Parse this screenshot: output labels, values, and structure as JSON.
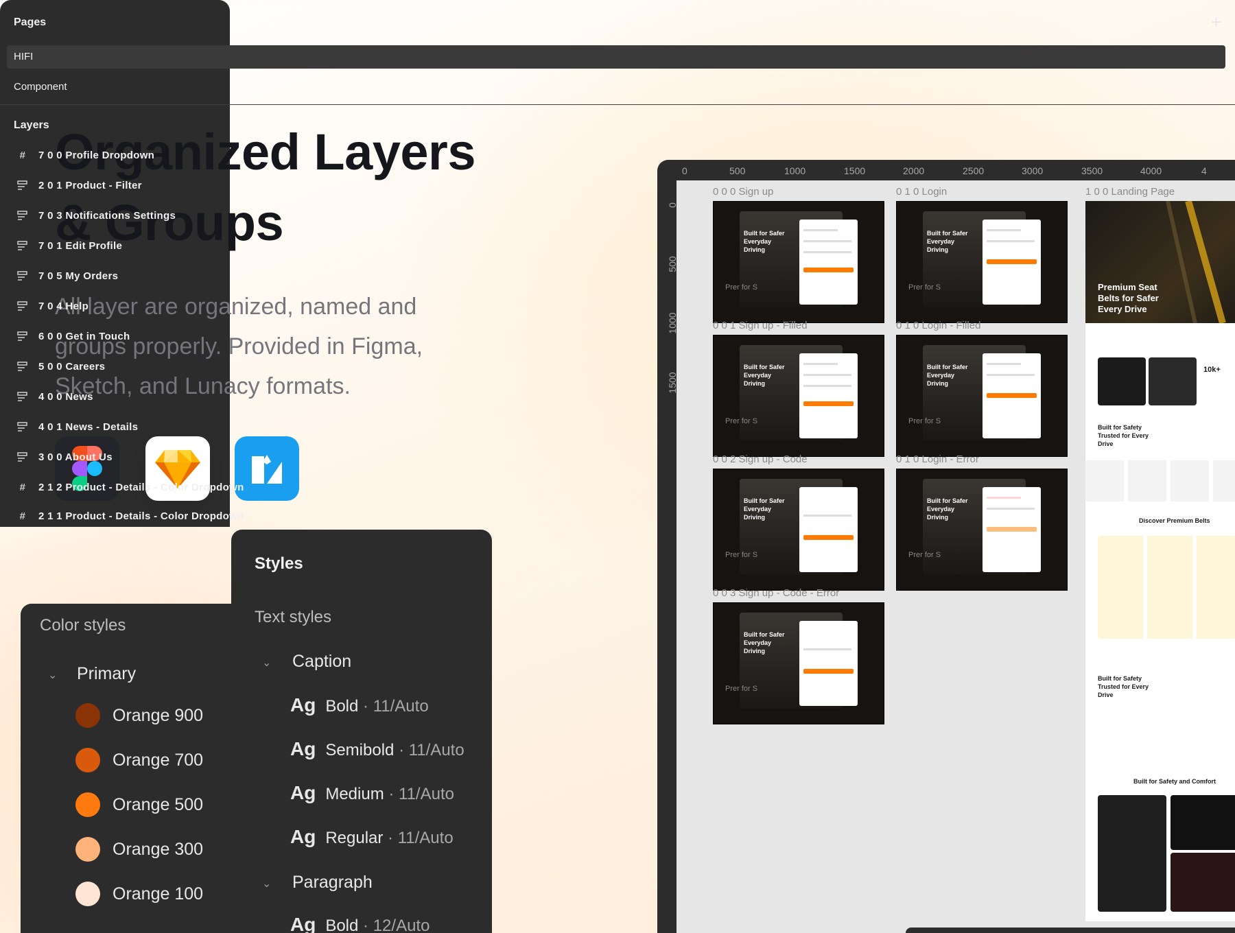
{
  "headline": {
    "line1": "Organized Layers",
    "line2": "& Groups"
  },
  "subtitle": "All layer are organized, named and groups properly. Provided in Figma, Sketch, and Lunacy formats.",
  "apps": [
    {
      "name": "Figma",
      "icon": "figma-icon"
    },
    {
      "name": "Sketch",
      "icon": "sketch-icon"
    },
    {
      "name": "Lunacy",
      "icon": "lunacy-icon"
    }
  ],
  "canvas": {
    "ruler_top": [
      "0",
      "500",
      "1000",
      "1500",
      "2000",
      "2500",
      "3000",
      "3500",
      "4000",
      "4"
    ],
    "ruler_left": [
      "0",
      "500",
      "1000",
      "1500"
    ],
    "frames": [
      {
        "label": "0 0 0 Sign up",
        "heading": "Built for Safer Everyday Driving",
        "side": "Prer for S"
      },
      {
        "label": "0 1 0 Login",
        "heading": "Built for Safer Everyday Driving",
        "side": "Prer for S"
      },
      {
        "label": "0 0 1 Sign up - Filled",
        "heading": "Built for Safer Everyday Driving",
        "side": "Prer for S"
      },
      {
        "label": "0 1 0 Login - Filled",
        "heading": "Built for Safer Everyday Driving",
        "side": "Prer for S"
      },
      {
        "label": "0 0 2 Sign up - Code",
        "heading": "Built for Safer Everyday Driving",
        "side": "Prer for S"
      },
      {
        "label": "0 1 0 Login - Error",
        "heading": "Built for Safer Everyday Driving",
        "side": "Prer for S"
      },
      {
        "label": "0 0 3 Sign up - Code - Error",
        "heading": "Built for Safer Everyday Driving",
        "side": "Prer for S"
      }
    ],
    "landing": {
      "label": "1 0 0 Landing Page",
      "hero": "Premium Seat Belts for Safer Every Drive",
      "sec1": "Built for Safety Trusted for Every Drive",
      "sec2": "Discover Premium Belts",
      "sec3": "Built for Safety Trusted for Every Drive",
      "sec4": "Built for Safety and Comfort",
      "stat": "10k+"
    }
  },
  "colors": {
    "title": "Color styles",
    "group": "Primary",
    "items": [
      {
        "name": "Orange 900",
        "hex": "#8a3306"
      },
      {
        "name": "Orange 700",
        "hex": "#d95a0d"
      },
      {
        "name": "Orange 500",
        "hex": "#ff7a0f"
      },
      {
        "name": "Orange 300",
        "hex": "#ffb27a"
      },
      {
        "name": "Orange 100",
        "hex": "#ffe6d4"
      }
    ]
  },
  "styles": {
    "title": "Styles",
    "text_title": "Text styles",
    "groups": [
      {
        "name": "Caption",
        "items": [
          {
            "ag": "Ag",
            "weight": "Bold",
            "meta": "· 11/Auto"
          },
          {
            "ag": "Ag",
            "weight": "Semibold",
            "meta": "· 11/Auto"
          },
          {
            "ag": "Ag",
            "weight": "Medium",
            "meta": "· 11/Auto"
          },
          {
            "ag": "Ag",
            "weight": "Regular",
            "meta": "· 11/Auto"
          }
        ]
      },
      {
        "name": "Paragraph",
        "items": [
          {
            "ag": "Ag",
            "weight": "Bold",
            "meta": "· 12/Auto"
          }
        ]
      }
    ]
  },
  "layers_panel": {
    "pages_title": "Pages",
    "add_label": "+",
    "pages": [
      "HIFI",
      "Component"
    ],
    "layers_title": "Layers",
    "layers": [
      {
        "icon": "frame-icon",
        "name": "7 0 0 Profile Dropdown"
      },
      {
        "icon": "section-icon",
        "name": "2 0 1 Product - Filter"
      },
      {
        "icon": "section-icon",
        "name": "7 0 3 Notifications Settings"
      },
      {
        "icon": "section-icon",
        "name": "7 0 1 Edit Profile"
      },
      {
        "icon": "section-icon",
        "name": "7 0 5 My Orders"
      },
      {
        "icon": "section-icon",
        "name": "7 0 4 Help"
      },
      {
        "icon": "section-icon",
        "name": "6 0 0 Get in Touch"
      },
      {
        "icon": "section-icon",
        "name": "5 0 0 Careers"
      },
      {
        "icon": "section-icon",
        "name": "4 0 0 News"
      },
      {
        "icon": "section-icon",
        "name": "4 0 1 News - Details"
      },
      {
        "icon": "section-icon",
        "name": "3 0 0 About Us"
      },
      {
        "icon": "frame-icon",
        "name": "2 1 2 Product - Details - Color Dropdown"
      },
      {
        "icon": "frame-icon",
        "name": "2 1 1 Product - Details - Color Dropdown"
      }
    ]
  }
}
